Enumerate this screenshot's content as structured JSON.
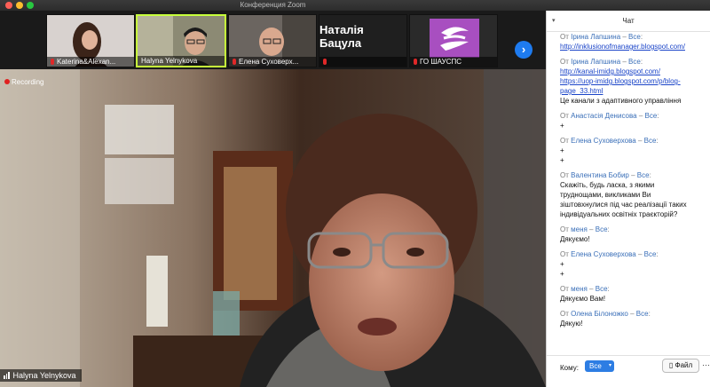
{
  "window": {
    "title": "Конференция Zoom"
  },
  "gallery": {
    "tiles": [
      {
        "name": "Katerina&Alexan...",
        "muted": true
      },
      {
        "name": "Halyna Yelnykova",
        "muted": false,
        "active": true
      },
      {
        "name": "Елена Суховерх...",
        "muted": true
      },
      {
        "name": "Наталія Бацула",
        "label": "Наталія Бацула",
        "muted": true
      },
      {
        "name": "ГО ШАУСПС",
        "muted": true
      }
    ],
    "next_icon": "chevron-right-icon"
  },
  "video": {
    "recording_label": "Recording",
    "speaker_name": "Halyna Yelnykova"
  },
  "chat": {
    "header": "Чат",
    "messages": [
      {
        "from": "Ірина Лапшина",
        "to": "Все",
        "lines": [
          "http://inklusionofmanager.blogspot.com/"
        ],
        "links": [
          true
        ]
      },
      {
        "from": "Ірина Лапшина",
        "to": "Все",
        "lines": [
          "http://kanal-imidg.blogspot.com/",
          "https://uop-imidg.blogspot.com/p/blog-",
          "page_33.html",
          "Це канали з адаптивного управління"
        ],
        "links": [
          true,
          true,
          true,
          false
        ]
      },
      {
        "from": "Анастасія Денисова",
        "to": "Все",
        "lines": [
          "+"
        ],
        "links": [
          false
        ]
      },
      {
        "from": "Елена Суховерхова",
        "to": "Все",
        "lines": [
          "+",
          "+"
        ],
        "links": [
          false,
          false
        ]
      },
      {
        "from": "Валентина Бобир",
        "to": "Все",
        "lines": [
          "Скажіть, будь ласка, з якими",
          "труднощами, викликами  Ви",
          "зіштовхнулися під час реалізації таких",
          "індивідуальних освітніх траєкторій?"
        ],
        "links": [
          false,
          false,
          false,
          false
        ]
      },
      {
        "from": "меня",
        "to": "Все",
        "lines": [
          "Дякуємо!"
        ],
        "links": [
          false
        ]
      },
      {
        "from": "Елена Суховерхова",
        "to": "Все",
        "lines": [
          "+",
          "+"
        ],
        "links": [
          false,
          false
        ]
      },
      {
        "from": "меня",
        "to": "Все",
        "lines": [
          "Дякуємо Вам!"
        ],
        "links": [
          false
        ]
      },
      {
        "from": "Олена Білоножко",
        "to": "Все",
        "lines": [
          "Дякую!"
        ],
        "links": [
          false
        ]
      }
    ],
    "from_prefix": "От",
    "to_separator": " – ",
    "to_suffix": ":",
    "footer": {
      "to_label": "Кому:",
      "recipient": "Все",
      "file_button": "Файл",
      "more": "⋯"
    }
  },
  "colors": {
    "accent": "#2d7de3",
    "active_speaker": "#c7ff3b",
    "recording": "#e02020"
  }
}
